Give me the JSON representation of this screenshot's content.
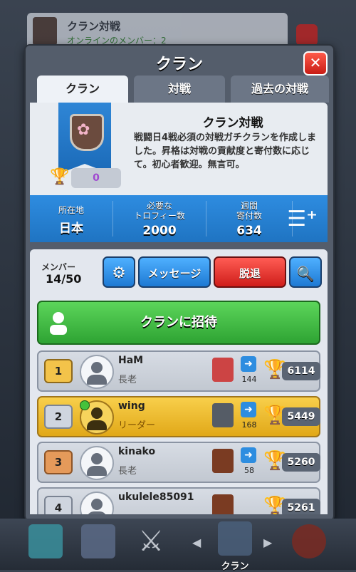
{
  "background_card": {
    "title": "クラン対戦",
    "subtitle": "オンラインのメンバー：2"
  },
  "panel": {
    "title": "クラン",
    "close_label": "✕"
  },
  "tabs": [
    {
      "label": "クラン",
      "active": true
    },
    {
      "label": "対戦",
      "active": false
    },
    {
      "label": "過去の対戦",
      "active": false
    }
  ],
  "clan": {
    "name": "クラン対戦",
    "description": "戦闘日4戦必須の対戦ガチクランを作成しました。昇格は対戦の貢献度と寄付数に応じて。初心者歓迎。無言可。",
    "war_trophies": "0",
    "badge_icon": "cherry-blossom-shield-icon"
  },
  "stats": [
    {
      "label": "所在地",
      "value": "日本"
    },
    {
      "label": "必要な\nトロフィー数",
      "value": "2000"
    },
    {
      "label": "週間\n寄付数",
      "value": "634"
    }
  ],
  "members_header": {
    "label": "メンバー",
    "count": "14/50",
    "message_label": "メッセージ",
    "leave_label": "脱退",
    "invite_label": "クランに招待"
  },
  "members": [
    {
      "rank": "1",
      "name": "HaM",
      "role": "長老",
      "donations": "144",
      "trophies": "6114",
      "online": false,
      "highlight": false
    },
    {
      "rank": "2",
      "name": "wing",
      "role": "リーダー",
      "donations": "168",
      "trophies": "5449",
      "online": true,
      "highlight": true
    },
    {
      "rank": "3",
      "name": "kinako",
      "role": "長老",
      "donations": "58",
      "trophies": "5260",
      "online": false,
      "highlight": false
    },
    {
      "rank": "4",
      "name": "ukulele85091",
      "role": "",
      "donations": "",
      "trophies": "5261",
      "online": false,
      "highlight": false
    }
  ],
  "bottom_nav": {
    "active_label": "クラン"
  },
  "colors": {
    "accent_blue": "#1f74c2",
    "leave_red": "#cf1e1a",
    "invite_green": "#2ea333",
    "leader_gold": "#e1a818"
  }
}
